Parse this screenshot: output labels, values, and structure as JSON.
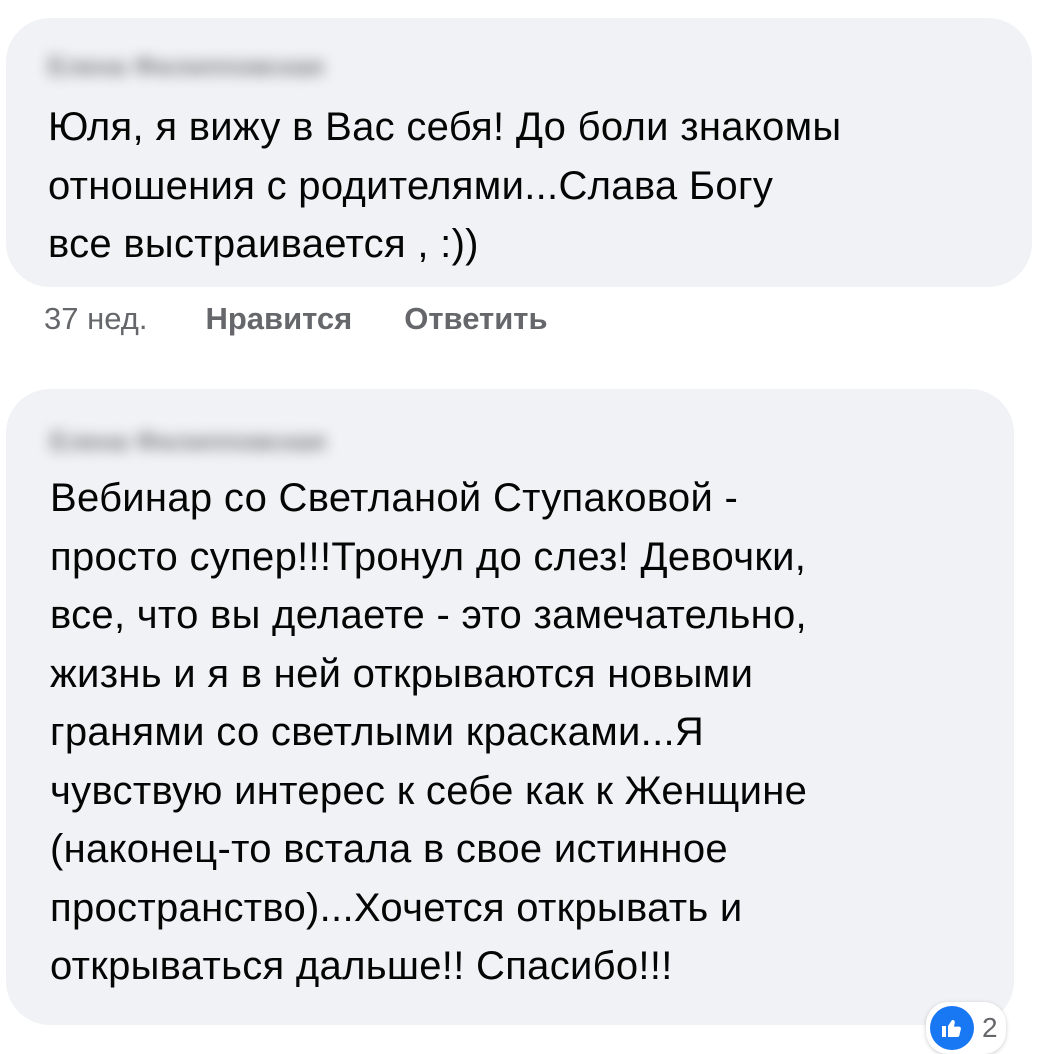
{
  "comments": [
    {
      "author": "Елена Филипповская",
      "text": "Юля, я вижу в Вас себя! До боли знакомы\nотношения с родителями...Слава Богу\nвсе выстраивается , :))",
      "age": "37 нед.",
      "like_label": "Нравится",
      "reply_label": "Ответить"
    },
    {
      "author": "Елена Филипповская",
      "text": "Вебинар со Светланой Ступаковой -\nпросто супер!!!Тронул до слез! Девочки,\nвсе, что вы делаете - это замечательно,\nжизнь и я в ней открываются новыми\nгранями со светлыми красками...Я\nчувствую интерес к себе как к Женщине\n(наконец-то встала в свое  истинное\nпространство)...Хочется открывать и\nоткрываться  дальше!! Спасибо!!!",
      "reaction_count": "2"
    }
  ],
  "icons": {
    "reaction": "thumbs-up-icon"
  },
  "colors": {
    "bubble": "#f0f2f5",
    "meta_text": "#65676b",
    "like_blue": "#1877f2"
  }
}
